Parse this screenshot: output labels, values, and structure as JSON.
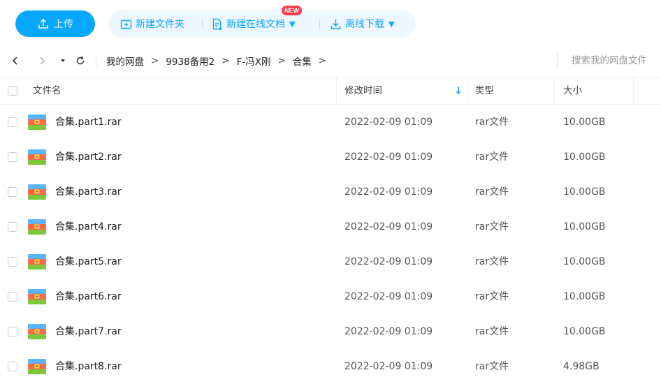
{
  "toolbar": {
    "upload_label": "上传",
    "new_folder_label": "新建文件夹",
    "new_online_doc_label": "新建在线文档",
    "new_badge": "NEW",
    "offline_download_label": "离线下载",
    "accent_color": "#06a7ff"
  },
  "nav": {
    "back_icon": "chevron-left-icon",
    "forward_icon": "chevron-right-icon",
    "history_icon": "triangle-down-icon",
    "refresh_icon": "refresh-icon",
    "breadcrumb": [
      "我的网盘",
      "9938备用2",
      "F-冯X刚",
      "合集"
    ],
    "separator": ">",
    "search_placeholder": "搜索我的网盘文件"
  },
  "table": {
    "headers": {
      "name": "文件名",
      "modified": "修改时间",
      "type": "类型",
      "size": "大小"
    },
    "sort_icon": "arrow-down-icon",
    "rows": [
      {
        "name": "合集.part1.rar",
        "modified": "2022-02-09 01:09",
        "type": "rar文件",
        "size": "10.00GB"
      },
      {
        "name": "合集.part2.rar",
        "modified": "2022-02-09 01:09",
        "type": "rar文件",
        "size": "10.00GB"
      },
      {
        "name": "合集.part3.rar",
        "modified": "2022-02-09 01:09",
        "type": "rar文件",
        "size": "10.00GB"
      },
      {
        "name": "合集.part4.rar",
        "modified": "2022-02-09 01:09",
        "type": "rar文件",
        "size": "10.00GB"
      },
      {
        "name": "合集.part5.rar",
        "modified": "2022-02-09 01:09",
        "type": "rar文件",
        "size": "10.00GB"
      },
      {
        "name": "合集.part6.rar",
        "modified": "2022-02-09 01:09",
        "type": "rar文件",
        "size": "10.00GB"
      },
      {
        "name": "合集.part7.rar",
        "modified": "2022-02-09 01:09",
        "type": "rar文件",
        "size": "10.00GB"
      },
      {
        "name": "合集.part8.rar",
        "modified": "2022-02-09 01:09",
        "type": "rar文件",
        "size": "4.98GB"
      }
    ]
  }
}
